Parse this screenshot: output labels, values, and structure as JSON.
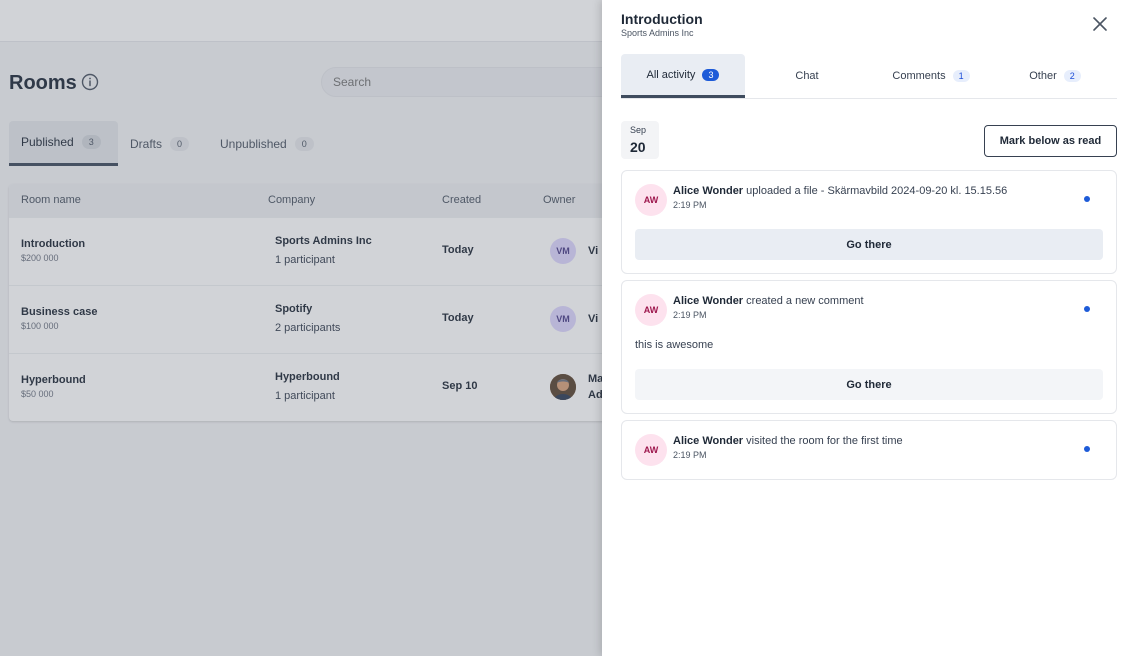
{
  "app": {
    "title": "Rooms",
    "search_placeholder": "Search",
    "tabs": [
      {
        "label": "Published",
        "count": "3"
      },
      {
        "label": "Drafts",
        "count": "0"
      },
      {
        "label": "Unpublished",
        "count": "0"
      }
    ],
    "table": {
      "headers": [
        "Room name",
        "Company",
        "Created",
        "Owner"
      ],
      "rows": [
        {
          "name": "Introduction",
          "value": "$200 000",
          "company": "Sports Admins Inc",
          "participants": "1 participant",
          "created": "Today",
          "owner_initials": "VM",
          "owner_name": "Vi"
        },
        {
          "name": "Business case",
          "value": "$100 000",
          "company": "Spotify",
          "participants": "2 participants",
          "created": "Today",
          "owner_initials": "VM",
          "owner_name": "Vi"
        },
        {
          "name": "Hyperbound",
          "value": "$50 000",
          "company": "Hyperbound",
          "participants": "1 participant",
          "created": "Sep 10",
          "owner_initials": "",
          "owner_name": "Ma\nAd"
        }
      ]
    }
  },
  "drawer": {
    "title": "Introduction",
    "subtitle": "Sports Admins Inc",
    "tabs": [
      {
        "label": "All activity",
        "count": "3"
      },
      {
        "label": "Chat",
        "count": ""
      },
      {
        "label": "Comments",
        "count": "1"
      },
      {
        "label": "Other",
        "count": "2"
      }
    ],
    "date": {
      "month": "Sep",
      "day": "20"
    },
    "mark_read_label": "Mark below as read",
    "activities": [
      {
        "initials": "AW",
        "user": "Alice Wonder",
        "action": " uploaded a file - Skärmavbild 2024-09-20 kl. 15.15.56",
        "time": "2:19 PM",
        "comment": "",
        "button": "Go there"
      },
      {
        "initials": "AW",
        "user": "Alice Wonder",
        "action": " created a new comment",
        "time": "2:19 PM",
        "comment": "this is awesome",
        "button": "Go there"
      },
      {
        "initials": "AW",
        "user": "Alice Wonder",
        "action": " visited the room for the first time",
        "time": "2:19 PM",
        "comment": "",
        "button": ""
      }
    ]
  },
  "colors": {
    "accent": "#1d5bd8",
    "tab_active_bar": "#3f4c5e",
    "avatar_pink": "#fde2ee",
    "avatar_purple": "#ddd6fe"
  },
  "icons": {
    "info": "info-icon",
    "close": "close-icon",
    "unread": "unread-dot-icon"
  }
}
